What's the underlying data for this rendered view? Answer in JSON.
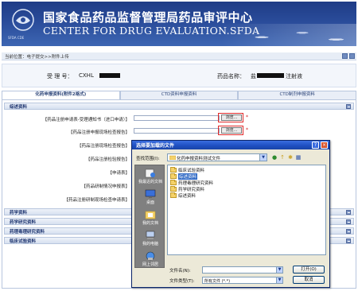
{
  "header": {
    "title_cn": "国家食品药品监督管理局药品审评中心",
    "title_en": "CENTER FOR DRUG EVALUATION.SFDA",
    "logo_text": "SFDA CDE"
  },
  "breadcrumb": {
    "text": "当前位置：电子提交>>附件上传"
  },
  "info": {
    "accept_label": "受 理 号：",
    "accept_value": "CXHL",
    "drug_label": "药品名称：",
    "drug_prefix": "盐",
    "drug_suffix": "注射液"
  },
  "tabs": [
    {
      "label": "化药申报资料(附件2格式)"
    },
    {
      "label": "CTD资料申报资料"
    },
    {
      "label": "CTD制剂申报资料"
    }
  ],
  "sections": {
    "summary": "综述资料",
    "pharma": "药学资料",
    "pharmacology": "药学研究资料",
    "toxicology": "药理毒理研究资料",
    "clinical": "临床试验资料"
  },
  "rows": [
    {
      "label": "【药品注册申请表-受理通知书（进口申请）】"
    },
    {
      "label": "【药品注册申报现场检查报告】"
    },
    {
      "label": "【药品注册现场检查报告】"
    },
    {
      "label": "【药品注册检验报告】"
    },
    {
      "label": "【申请表】"
    },
    {
      "label": "【药品研制情况申报表】"
    },
    {
      "label": "【药品注册研制现场检查申请表】"
    }
  ],
  "browse_label": "浏览...",
  "required_mark": "*",
  "dialog": {
    "title": "选择要加载的文件",
    "lookin_label": "查找范围(I):",
    "lookin_value": "化药申报资料测试文件",
    "places": [
      "我最近的文档",
      "桌面",
      "我的文档",
      "我的电脑",
      "网上邻居"
    ],
    "files": [
      "临床试验资料",
      "综述资料",
      "药理毒理研究资料",
      "药学研究资料",
      "综述资料"
    ],
    "selected_index": 1,
    "filename_label": "文件名(N):",
    "filename_value": "",
    "filetype_label": "文件类型(T):",
    "filetype_value": "所有文件 (*.*)",
    "open_label": "打开(O)",
    "cancel_label": "取消"
  }
}
